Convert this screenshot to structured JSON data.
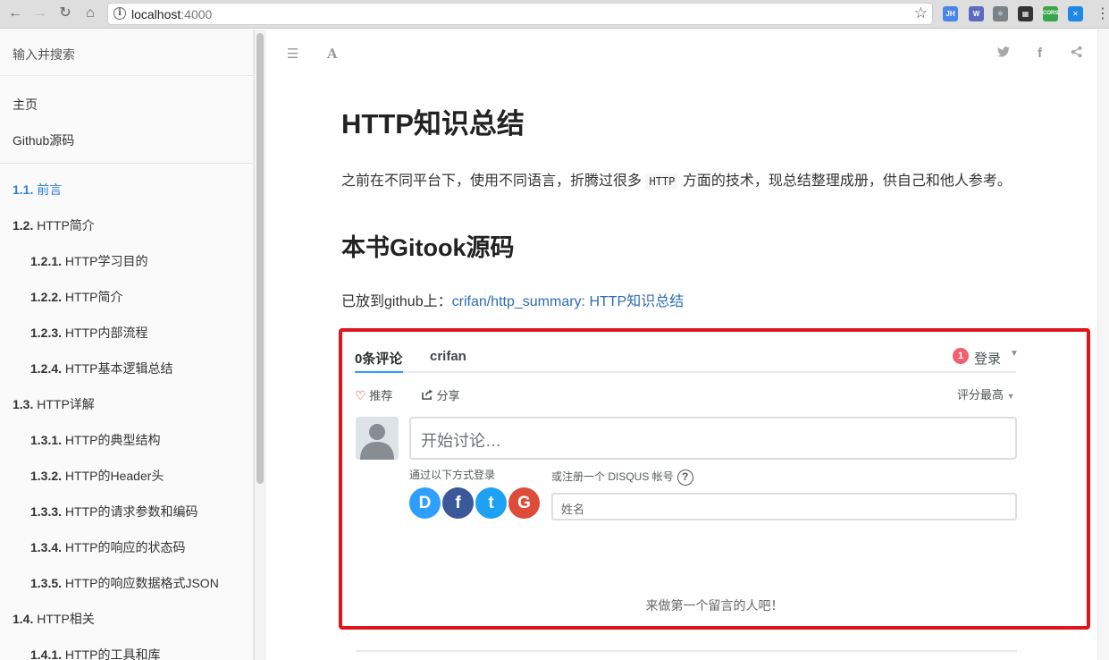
{
  "browser": {
    "url_host": "localhost",
    "url_port": ":4000",
    "extensions": [
      {
        "name": "jh-extension-icon",
        "label": "JH",
        "color": "#4a86e8"
      },
      {
        "name": "web-extension-icon",
        "label": "W",
        "color": "#5c6bc0"
      },
      {
        "name": "react-extension-icon",
        "label": "⚛",
        "color": "#7a8288"
      },
      {
        "name": "qr-extension-icon",
        "label": "▦",
        "color": "#333333"
      },
      {
        "name": "cors-extension-icon",
        "label": "CORS",
        "color": "#3aa64a"
      },
      {
        "name": "blue-x-extension-icon",
        "label": "✕",
        "color": "#1e88e5"
      }
    ]
  },
  "sidebar": {
    "search_placeholder": "输入并搜索",
    "top_links": [
      "主页",
      "Github源码"
    ],
    "toc": [
      {
        "num": "1.1.",
        "label": "前言",
        "level": 1,
        "active": true
      },
      {
        "num": "1.2.",
        "label": "HTTP简介",
        "level": 1
      },
      {
        "num": "1.2.1.",
        "label": "HTTP学习目的",
        "level": 2
      },
      {
        "num": "1.2.2.",
        "label": "HTTP简介",
        "level": 2
      },
      {
        "num": "1.2.3.",
        "label": "HTTP内部流程",
        "level": 2
      },
      {
        "num": "1.2.4.",
        "label": "HTTP基本逻辑总结",
        "level": 2
      },
      {
        "num": "1.3.",
        "label": "HTTP详解",
        "level": 1
      },
      {
        "num": "1.3.1.",
        "label": "HTTP的典型结构",
        "level": 2
      },
      {
        "num": "1.3.2.",
        "label": "HTTP的Header头",
        "level": 2
      },
      {
        "num": "1.3.3.",
        "label": "HTTP的请求参数和编码",
        "level": 2
      },
      {
        "num": "1.3.4.",
        "label": "HTTP的响应的状态码",
        "level": 2
      },
      {
        "num": "1.3.5.",
        "label": "HTTP的响应数据格式JSON",
        "level": 2
      },
      {
        "num": "1.4.",
        "label": "HTTP相关",
        "level": 1
      },
      {
        "num": "1.4.1.",
        "label": "HTTP的工具和库",
        "level": 2
      }
    ]
  },
  "main": {
    "title": "HTTP知识总结",
    "intro_before": "之前在不同平台下，使用不同语言，折腾过很多",
    "intro_code": "HTTP",
    "intro_after": "方面的技术，现总结整理成册，供自己和他人参考。",
    "section_title": "本书Gitook源码",
    "repo_prefix": "已放到github上：",
    "repo_link": "crifan/http_summary: HTTP知识总结"
  },
  "disqus": {
    "tab_comments": "0条评论",
    "tab_site": "crifan",
    "notification_count": "1",
    "login_label": "登录",
    "recommend_label": "推荐",
    "share_label": "分享",
    "sort_label": "评分最高",
    "comment_placeholder": "开始讨论…",
    "login_with_label": "通过以下方式登录",
    "register_label": "或注册一个 DISQUS 帐号",
    "help_label": "?",
    "name_placeholder": "姓名",
    "empty_message": "来做第一个留言的人吧！",
    "social": [
      {
        "name": "disqus",
        "letter": "D",
        "color": "#2e9fff"
      },
      {
        "name": "facebook",
        "letter": "f",
        "color": "#3b5998"
      },
      {
        "name": "twitter",
        "letter": "t",
        "color": "#1da1f2"
      },
      {
        "name": "google",
        "letter": "G",
        "color": "#dd4b39"
      }
    ]
  }
}
